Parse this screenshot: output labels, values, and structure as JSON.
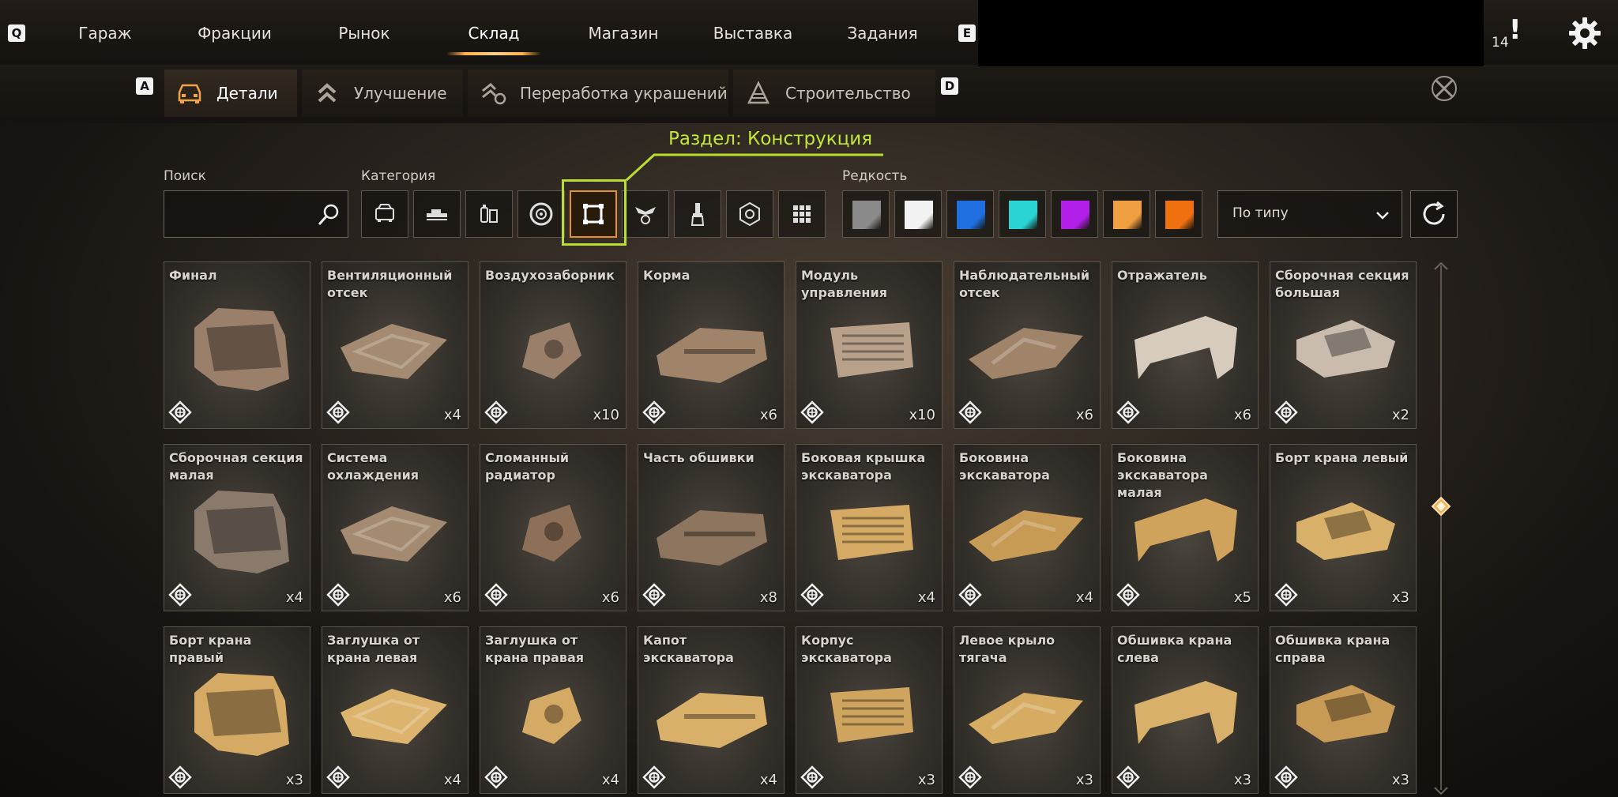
{
  "topnav": {
    "left_key": "Q",
    "right_key": "E",
    "tabs": [
      "Гараж",
      "Фракции",
      "Рынок",
      "Склад",
      "Магазин",
      "Выставка",
      "Задания"
    ],
    "active_tab": "Склад",
    "notification_count": "14",
    "notification_mark": "!"
  },
  "subnav": {
    "left_key": "A",
    "right_key": "D",
    "tabs": [
      "Детали",
      "Улучшение",
      "Переработка украшений",
      "Строительство"
    ],
    "active_tab": "Детали"
  },
  "filters": {
    "search_label": "Поиск",
    "search_value": "",
    "category_label": "Категория",
    "categories": [
      "cabin-icon",
      "weapon-icon",
      "module-icon",
      "wheel-icon",
      "frame-structure-icon",
      "decor-icon",
      "paint-brush-icon",
      "resource-icon",
      "all-grid-icon"
    ],
    "active_category": "frame-structure-icon",
    "rarity_label": "Редкость",
    "rarities": [
      "#8a8a8a",
      "#f2f2f2",
      "#1f6fe0",
      "#2ad4d4",
      "#b21fe8",
      "#f0a040",
      "#f07010"
    ],
    "sort_value": "По типу",
    "annotation_text": "Раздел: Конструкция",
    "annotation_color": "#c4e636"
  },
  "items": [
    {
      "name": "Финал",
      "qty": "",
      "color": "#9a7f6a"
    },
    {
      "name": "Вентиляционный отсек",
      "qty": "x4",
      "color": "#a48a70"
    },
    {
      "name": "Воздухозаборник",
      "qty": "x10",
      "color": "#9a7f6a"
    },
    {
      "name": "Корма",
      "qty": "x6",
      "color": "#a08469"
    },
    {
      "name": "Модуль управления",
      "qty": "x10",
      "color": "#b8a08a"
    },
    {
      "name": "Наблюдательный отсек",
      "qty": "x6",
      "color": "#a08469"
    },
    {
      "name": "Отражатель",
      "qty": "x6",
      "color": "#d7cbbd"
    },
    {
      "name": "Сборочная секция большая",
      "qty": "x2",
      "color": "#c9bcae"
    },
    {
      "name": "Сборочная секция малая",
      "qty": "x4",
      "color": "#8a7a6c"
    },
    {
      "name": "Система охлаждения",
      "qty": "x6",
      "color": "#a48a70"
    },
    {
      "name": "Сломанный радиатор",
      "qty": "x6",
      "color": "#8e6f58"
    },
    {
      "name": "Часть обшивки",
      "qty": "x8",
      "color": "#8e7560"
    },
    {
      "name": "Боковая крышка экскаватора",
      "qty": "x4",
      "color": "#d4aa64"
    },
    {
      "name": "Боковина экскаватора",
      "qty": "x4",
      "color": "#c79a55"
    },
    {
      "name": "Боковина экскаватора малая",
      "qty": "x5",
      "color": "#d0a35c"
    },
    {
      "name": "Борт крана левый",
      "qty": "x3",
      "color": "#d9b069"
    },
    {
      "name": "Борт крана правый",
      "qty": "x3",
      "color": "#d4aa64"
    },
    {
      "name": "Заглушка от крана левая",
      "qty": "x4",
      "color": "#dcb46e"
    },
    {
      "name": "Заглушка от крана правая",
      "qty": "x4",
      "color": "#d4aa64"
    },
    {
      "name": "Капот экскаватора",
      "qty": "x4",
      "color": "#d8b06a"
    },
    {
      "name": "Корпус экскаватора",
      "qty": "x3",
      "color": "#cfa45e"
    },
    {
      "name": "Левое крыло тягача",
      "qty": "x3",
      "color": "#d6ab62"
    },
    {
      "name": "Обшивка крана слева",
      "qty": "x3",
      "color": "#d9b069"
    },
    {
      "name": "Обшивка крана справа",
      "qty": "x3",
      "color": "#c79a55"
    }
  ]
}
